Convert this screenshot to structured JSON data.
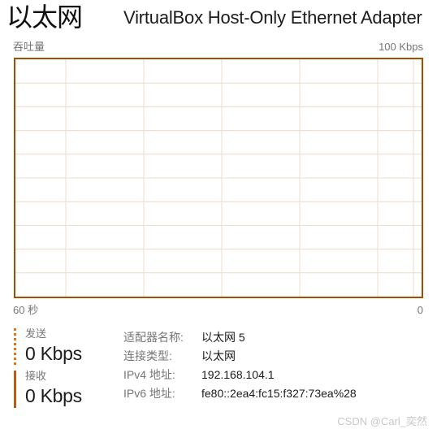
{
  "header": {
    "adapter_logo": "以太网",
    "adapter_title": "VirtualBox Host-Only Ethernet Adapter"
  },
  "graph": {
    "y_axis_label": "吞吐量",
    "y_axis_max": "100 Kbps",
    "x_axis_left": "60 秒",
    "x_axis_right": "0",
    "border_color": "#a05000",
    "grid_color": "#ebdcc8"
  },
  "legend": {
    "send": {
      "name": "发送",
      "value": "0 Kbps",
      "marker_style": "dotted",
      "color": "#e8730c"
    },
    "receive": {
      "name": "接收",
      "value": "0 Kbps",
      "marker_style": "solid",
      "color": "#c05a10"
    }
  },
  "details": {
    "rows": [
      {
        "label": "适配器名称:",
        "value": "以太网 5"
      },
      {
        "label": "连接类型:",
        "value": "以太网"
      },
      {
        "label": "IPv4 地址:",
        "value": "192.168.104.1"
      },
      {
        "label": "IPv6 地址:",
        "value": "fe80::2ea4:fc15:f327:73ea%28"
      }
    ]
  },
  "watermark": {
    "text": "CSDN @Carl_奕然"
  },
  "chart_data": {
    "type": "line",
    "title": "吞吐量",
    "xlabel": "",
    "ylabel": "吞吐量",
    "ylim": [
      0,
      100
    ],
    "xlim": [
      60,
      0
    ],
    "y_unit": "Kbps",
    "y_max_label": "100 Kbps",
    "x_left_label": "60 秒",
    "x_right_label": "0",
    "x_direction": "right-to-left",
    "grid": true,
    "grid_rows": 10,
    "grid_cols": 6,
    "legend_position": "below-left",
    "series": [
      {
        "name": "发送",
        "unit": "Kbps",
        "current": 0,
        "style": "dotted",
        "color": "#e8730c",
        "values": [
          0,
          0,
          0,
          0,
          0,
          0,
          0,
          0,
          0,
          0,
          0,
          0,
          0,
          0,
          0,
          0,
          0,
          0,
          0,
          0,
          0,
          0,
          0,
          0,
          0,
          0,
          0,
          0,
          0,
          0,
          0,
          0,
          0,
          0,
          0,
          0,
          0,
          0,
          0,
          0,
          0,
          0,
          0,
          0,
          0,
          0,
          0,
          0,
          0,
          0,
          0,
          0,
          0,
          0,
          0,
          0,
          0,
          0,
          0,
          0,
          0
        ]
      },
      {
        "name": "接收",
        "unit": "Kbps",
        "current": 0,
        "style": "solid",
        "color": "#c05a10",
        "values": [
          0,
          0,
          0,
          0,
          0,
          0,
          0,
          0,
          0,
          0,
          0,
          0,
          0,
          0,
          0,
          0,
          0,
          0,
          0,
          0,
          0,
          0,
          0,
          0,
          0,
          0,
          0,
          0,
          0,
          0,
          0,
          0,
          0,
          0,
          0,
          0,
          0,
          0,
          0,
          0,
          0,
          0,
          0,
          0,
          0,
          0,
          0,
          0,
          0,
          0,
          0,
          0,
          0,
          0,
          0,
          0,
          0,
          0,
          0,
          0,
          0
        ]
      }
    ]
  }
}
